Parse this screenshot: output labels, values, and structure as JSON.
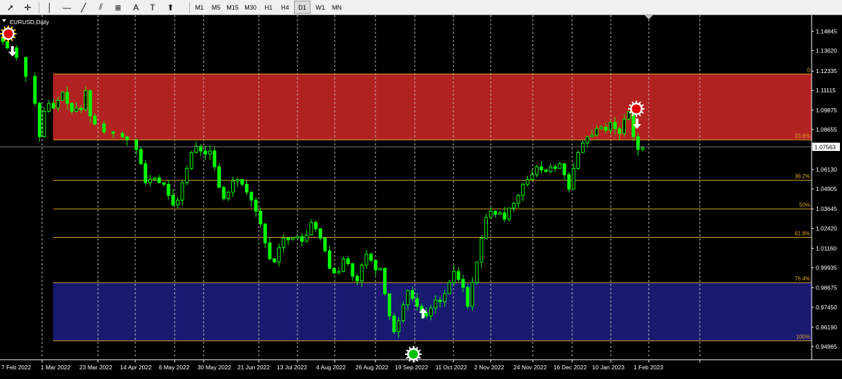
{
  "toolbar": {
    "tools": [
      {
        "name": "cursor-icon",
        "glyph": "➚"
      },
      {
        "name": "crosshair-icon",
        "glyph": "✛"
      },
      {
        "name": "vertical-line-icon",
        "glyph": "│"
      },
      {
        "name": "horizontal-line-icon",
        "glyph": "—"
      },
      {
        "name": "trendline-icon",
        "glyph": "╱"
      },
      {
        "name": "equidistant-channel-icon",
        "glyph": "⫽"
      },
      {
        "name": "fibonacci-icon",
        "glyph": "≣"
      },
      {
        "name": "text-icon",
        "glyph": "A"
      },
      {
        "name": "text-label-icon",
        "glyph": "T"
      },
      {
        "name": "arrows-icon",
        "glyph": "⬆"
      }
    ],
    "timeframes": [
      "M1",
      "M5",
      "M15",
      "M30",
      "H1",
      "H4",
      "D1",
      "W1",
      "MN"
    ],
    "active_timeframe": "D1"
  },
  "chart": {
    "symbol_label": "EURUSD,Daily",
    "current_price": "1.07563",
    "background": "#000000",
    "candle_color": "#00ff00",
    "price_axis": [
      "1.14845",
      "1.13620",
      "1.12335",
      "1.11115",
      "1.09875",
      "1.08655",
      "1.07430",
      "1.06130",
      "1.04905",
      "1.03645",
      "1.02420",
      "1.01160",
      "0.99935",
      "0.98675",
      "0.97450",
      "0.96190",
      "0.94965"
    ],
    "date_axis": [
      "7 Feb 2022",
      "1 Mar 2022",
      "23 Mar 2022",
      "14 Apr 2022",
      "6 May 2022",
      "30 May 2022",
      "21 Jun 2022",
      "13 Jul 2022",
      "4 Aug 2022",
      "26 Aug 2022",
      "19 Sep 2022",
      "11 Oct 2022",
      "2 Nov 2022",
      "24 Nov 2022",
      "16 Dec 2022",
      "10 Jan 2023",
      "1 Feb 2023"
    ],
    "fibonacci": {
      "levels": [
        {
          "label": "0",
          "price": 1.1215
        },
        {
          "label": "23.6%",
          "price": 1.08
        },
        {
          "label": "38.2%",
          "price": 1.0545
        },
        {
          "label": "50%",
          "price": 1.0365
        },
        {
          "label": "61.8%",
          "price": 1.0185
        },
        {
          "label": "76.4%",
          "price": 0.99
        },
        {
          "label": "100%",
          "price": 0.9533
        }
      ],
      "upper_zone_color": "#b22222",
      "lower_zone_color": "#191970",
      "line_color": "#daa520"
    },
    "signals": [
      {
        "type": "sell",
        "marker": "red-circle"
      },
      {
        "type": "buy",
        "marker": "green-circle"
      },
      {
        "type": "sell",
        "marker": "red-circle"
      }
    ]
  },
  "chart_data": {
    "type": "candlestick",
    "title": "EURUSD,Daily",
    "x": [
      "7 Feb 2022",
      "1 Mar 2022",
      "23 Mar 2022",
      "14 Apr 2022",
      "6 May 2022",
      "30 May 2022",
      "21 Jun 2022",
      "13 Jul 2022",
      "4 Aug 2022",
      "26 Aug 2022",
      "19 Sep 2022",
      "11 Oct 2022",
      "2 Nov 2022",
      "24 Nov 2022",
      "16 Dec 2022",
      "10 Jan 2023",
      "1 Feb 2023"
    ],
    "ylim": [
      0.944,
      1.156
    ],
    "close_path": [
      [
        0,
        1.142
      ],
      [
        1,
        1.138
      ],
      [
        3,
        1.132
      ],
      [
        5,
        1.12
      ],
      [
        7,
        1.103
      ],
      [
        8,
        1.082
      ],
      [
        9,
        1.098
      ],
      [
        10,
        1.103
      ],
      [
        11,
        1.1
      ],
      [
        12,
        1.105
      ],
      [
        13,
        1.11
      ],
      [
        14,
        1.103
      ],
      [
        15,
        1.098
      ],
      [
        16,
        1.1
      ],
      [
        17,
        1.099
      ],
      [
        18,
        1.111
      ],
      [
        19,
        1.095
      ],
      [
        20,
        1.09
      ],
      [
        22,
        1.085
      ],
      [
        24,
        1.084
      ],
      [
        26,
        1.082
      ],
      [
        27,
        1.08
      ],
      [
        29,
        1.074
      ],
      [
        30,
        1.065
      ],
      [
        31,
        1.053
      ],
      [
        32,
        1.055
      ],
      [
        33,
        1.056
      ],
      [
        34,
        1.053
      ],
      [
        35,
        1.052
      ],
      [
        36,
        1.045
      ],
      [
        37,
        1.039
      ],
      [
        38,
        1.042
      ],
      [
        39,
        1.053
      ],
      [
        40,
        1.062
      ],
      [
        41,
        1.072
      ],
      [
        42,
        1.076
      ],
      [
        43,
        1.073
      ],
      [
        44,
        1.071
      ],
      [
        45,
        1.073
      ],
      [
        46,
        1.063
      ],
      [
        47,
        1.05
      ],
      [
        48,
        1.043
      ],
      [
        49,
        1.047
      ],
      [
        50,
        1.054
      ],
      [
        51,
        1.055
      ],
      [
        52,
        1.052
      ],
      [
        53,
        1.047
      ],
      [
        54,
        1.042
      ],
      [
        55,
        1.035
      ],
      [
        56,
        1.027
      ],
      [
        57,
        1.015
      ],
      [
        58,
        1.005
      ],
      [
        59,
        1.003
      ],
      [
        60,
        1.012
      ],
      [
        61,
        1.018
      ],
      [
        62,
        1.017
      ],
      [
        63,
        1.018
      ],
      [
        64,
        1.019
      ],
      [
        65,
        1.016
      ],
      [
        66,
        1.02
      ],
      [
        67,
        1.028
      ],
      [
        68,
        1.024
      ],
      [
        69,
        1.018
      ],
      [
        70,
        1.01
      ],
      [
        71,
        0.999
      ],
      [
        72,
        0.996
      ],
      [
        73,
        0.997
      ],
      [
        74,
        1.005
      ],
      [
        75,
        1.002
      ],
      [
        76,
        0.994
      ],
      [
        77,
        0.991
      ],
      [
        78,
        1.001
      ],
      [
        79,
        1.008
      ],
      [
        80,
        1.004
      ],
      [
        81,
        0.998
      ],
      [
        82,
        0.999
      ],
      [
        83,
        0.983
      ],
      [
        84,
        0.969
      ],
      [
        85,
        0.959
      ],
      [
        86,
        0.966
      ],
      [
        87,
        0.976
      ],
      [
        88,
        0.985
      ],
      [
        89,
        0.98
      ],
      [
        90,
        0.975
      ],
      [
        91,
        0.971
      ],
      [
        92,
        0.969
      ],
      [
        93,
        0.974
      ],
      [
        94,
        0.979
      ],
      [
        95,
        0.978
      ],
      [
        96,
        0.983
      ],
      [
        97,
        0.99
      ],
      [
        98,
        0.997
      ],
      [
        99,
        0.992
      ],
      [
        100,
        0.987
      ],
      [
        101,
        0.975
      ],
      [
        102,
        0.99
      ],
      [
        103,
        1.003
      ],
      [
        104,
        1.018
      ],
      [
        105,
        1.031
      ],
      [
        106,
        1.035
      ],
      [
        107,
        1.033
      ],
      [
        108,
        1.034
      ],
      [
        109,
        1.03
      ],
      [
        110,
        1.037
      ],
      [
        111,
        1.04
      ],
      [
        112,
        1.045
      ],
      [
        113,
        1.052
      ],
      [
        114,
        1.055
      ],
      [
        115,
        1.058
      ],
      [
        116,
        1.063
      ],
      [
        117,
        1.061
      ],
      [
        118,
        1.06
      ],
      [
        119,
        1.063
      ],
      [
        120,
        1.062
      ],
      [
        121,
        1.065
      ],
      [
        122,
        1.058
      ],
      [
        123,
        1.049
      ],
      [
        124,
        1.062
      ],
      [
        125,
        1.072
      ],
      [
        126,
        1.078
      ],
      [
        127,
        1.082
      ],
      [
        128,
        1.083
      ],
      [
        129,
        1.087
      ],
      [
        130,
        1.088
      ],
      [
        131,
        1.086
      ],
      [
        132,
        1.091
      ],
      [
        133,
        1.087
      ],
      [
        134,
        1.084
      ],
      [
        135,
        1.093
      ],
      [
        136,
        1.098
      ],
      [
        137,
        1.082
      ],
      [
        138,
        1.074
      ],
      [
        139,
        1.075
      ]
    ]
  }
}
